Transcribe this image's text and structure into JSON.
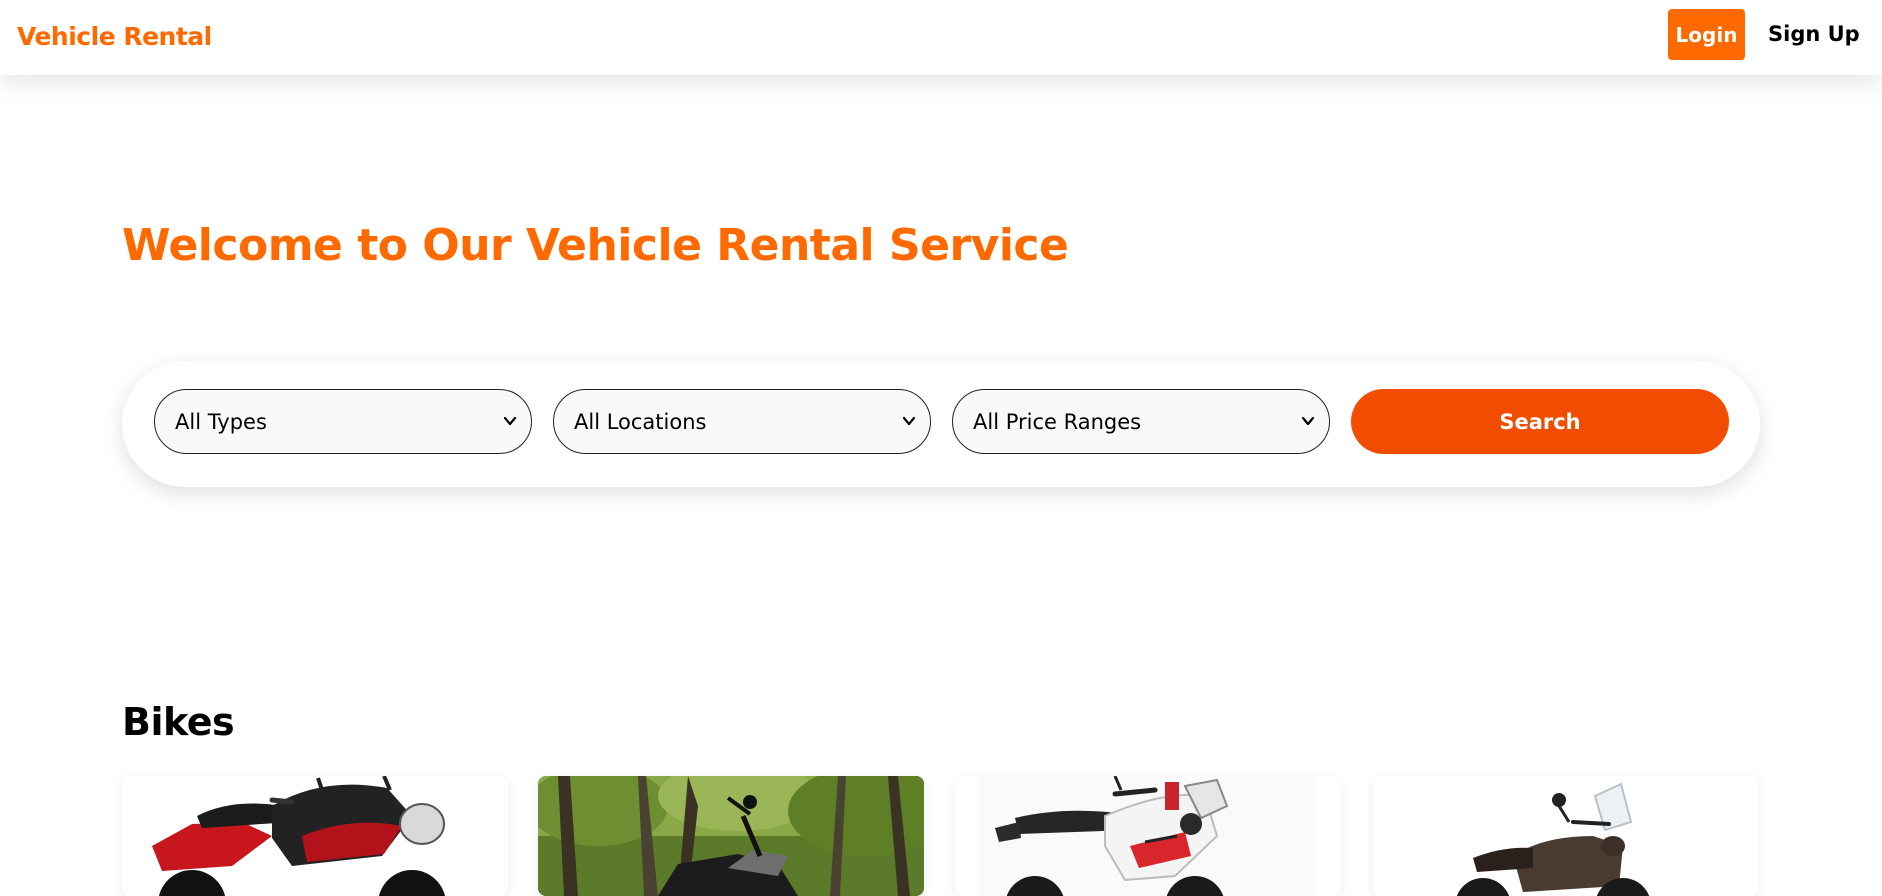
{
  "navbar": {
    "brand": "Vehicle Rental",
    "login_label": "Login",
    "signup_label": "Sign Up"
  },
  "hero": {
    "title": "Welcome to Our Vehicle Rental Service"
  },
  "search": {
    "type_select": {
      "selected": "All Types"
    },
    "location_select": {
      "selected": "All Locations"
    },
    "price_select": {
      "selected": "All Price Ranges"
    },
    "button_label": "Search"
  },
  "bikes": {
    "title": "Bikes",
    "cards": [
      {
        "image": "red-black-motorcycle"
      },
      {
        "image": "motorcycle-in-forest"
      },
      {
        "image": "white-adventure-motorcycle"
      },
      {
        "image": "brown-scooter-motorcycle"
      }
    ]
  },
  "colors": {
    "brand": "#ff6a00",
    "search_button": "#f24c00",
    "select_background": "#f7f9fb"
  },
  "icons": {
    "select_arrow": "chevron-down-icon"
  }
}
